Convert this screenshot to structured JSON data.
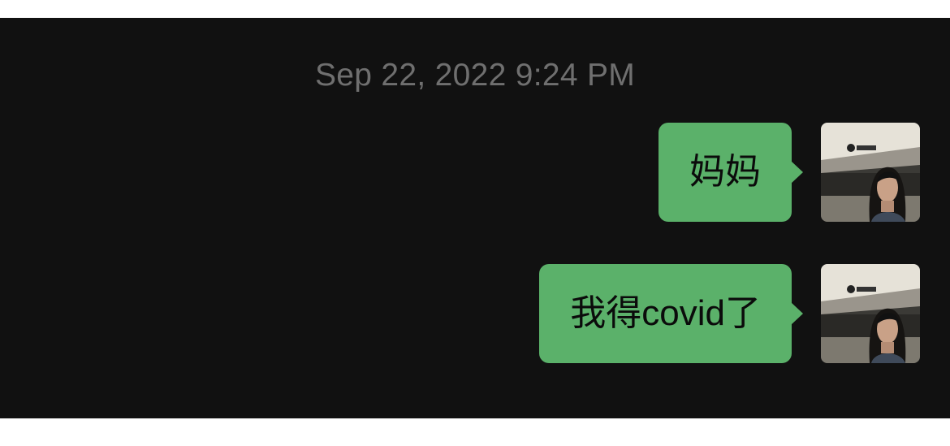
{
  "conversation": {
    "timestamp": "Sep 22, 2022 9:24 PM",
    "messages": [
      {
        "sender": "self",
        "text": "妈妈",
        "avatar_icon": "user-avatar"
      },
      {
        "sender": "self",
        "text": "我得covid了",
        "avatar_icon": "user-avatar"
      }
    ]
  },
  "colors": {
    "background": "#111111",
    "outgoing_bubble": "#5bb16a",
    "timestamp_text": "#6f6f6f"
  }
}
